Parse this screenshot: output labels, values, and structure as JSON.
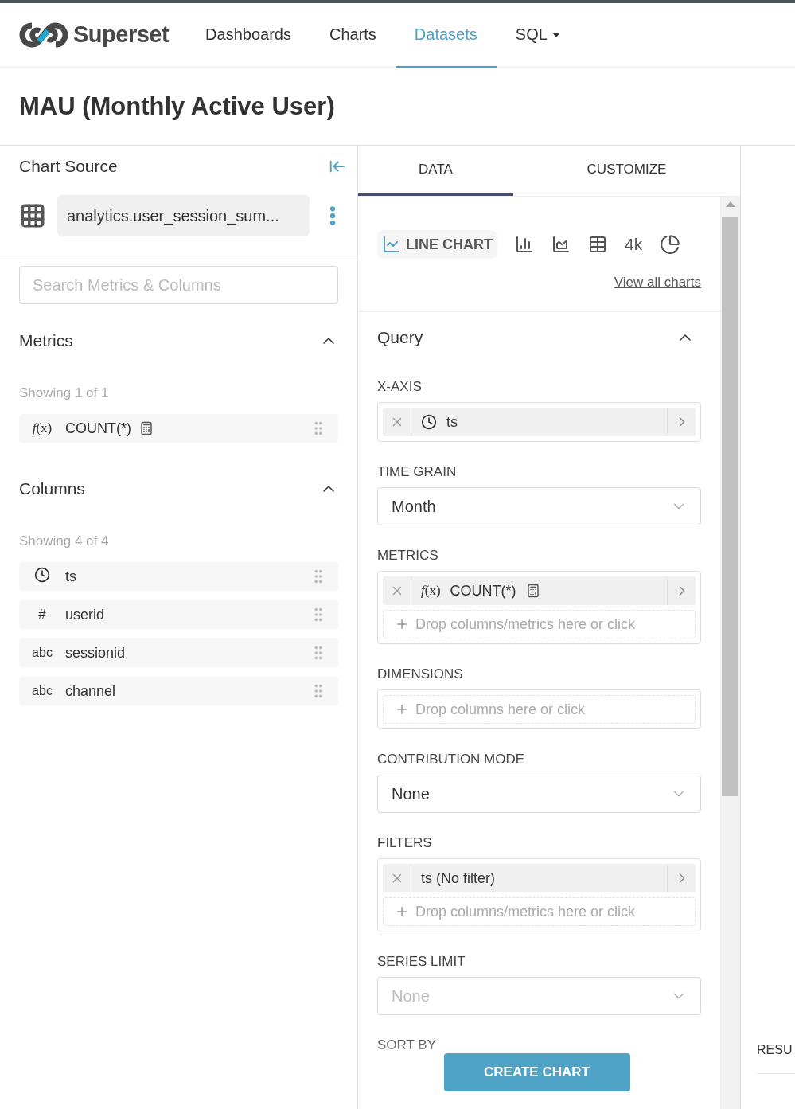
{
  "nav": {
    "brand": "Superset",
    "items": [
      {
        "label": "Dashboards",
        "selected": false,
        "kind": "link"
      },
      {
        "label": "Charts",
        "selected": false,
        "kind": "link"
      },
      {
        "label": "Datasets",
        "selected": true,
        "kind": "link"
      },
      {
        "label": "SQL",
        "selected": false,
        "kind": "dropdown"
      }
    ]
  },
  "title": "MAU (Monthly Active User)",
  "chart_source": {
    "heading": "Chart Source",
    "dataset": "analytics.user_session_sum..."
  },
  "search": {
    "placeholder": "Search Metrics & Columns"
  },
  "sections": [
    {
      "heading": "Metrics",
      "expanded": true,
      "showing": "Showing 1 of 1",
      "items": [
        {
          "kind": "metric",
          "type_label": "*f*(x)",
          "name": "COUNT(*)"
        }
      ]
    },
    {
      "heading": "Columns",
      "expanded": true,
      "showing": "Showing 4 of 4",
      "items": [
        {
          "kind": "temporal",
          "name": "ts"
        },
        {
          "kind": "numeric",
          "type_label": "#",
          "name": "userid"
        },
        {
          "kind": "string",
          "type_label": "abc",
          "name": "sessionid"
        },
        {
          "kind": "string",
          "type_label": "abc",
          "name": "channel"
        }
      ]
    }
  ],
  "tabs": [
    {
      "label": "DATA",
      "selected": true
    },
    {
      "label": "CUSTOMIZE",
      "selected": false
    }
  ],
  "chart_types": [
    {
      "kind": "line",
      "label": "LINE CHART",
      "selected": true
    },
    {
      "kind": "bar",
      "selected": false
    },
    {
      "kind": "area",
      "selected": false
    },
    {
      "kind": "table",
      "selected": false
    },
    {
      "kind": "big_number",
      "label": "4k",
      "selected": false
    },
    {
      "kind": "pie",
      "selected": false
    }
  ],
  "view_all": "View all charts",
  "query": {
    "heading": "Query",
    "expanded": true
  },
  "controls": [
    {
      "kind": "tags",
      "label": "X-AXIS",
      "tags": [
        {
          "kind": "temporal",
          "text": "ts"
        }
      ]
    },
    {
      "kind": "select",
      "label": "TIME GRAIN",
      "value": "Month"
    },
    {
      "kind": "tags",
      "label": "METRICS",
      "tags": [
        {
          "kind": "metric",
          "prefix": "*f*(x)",
          "text": "COUNT(*)"
        }
      ],
      "placeholder": "Drop columns/metrics here or click"
    },
    {
      "kind": "tags",
      "label": "DIMENSIONS",
      "placeholder": "Drop columns here or click"
    },
    {
      "kind": "select",
      "label": "CONTRIBUTION MODE",
      "value": "None"
    },
    {
      "kind": "tags",
      "label": "FILTERS",
      "tags": [
        {
          "kind": "filter",
          "text": "ts (No filter)"
        }
      ],
      "placeholder": "Drop columns/metrics here or click"
    },
    {
      "kind": "select",
      "label": "SERIES LIMIT",
      "placeholder": "None"
    },
    {
      "kind": "cut",
      "label": "SORT BY"
    }
  ],
  "create_button": "CREATE CHART",
  "results": {
    "heading": "RESU"
  }
}
